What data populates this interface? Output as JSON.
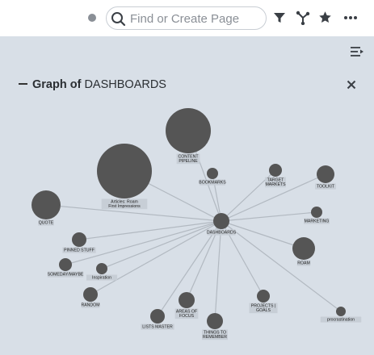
{
  "topbar": {
    "search_placeholder": "Find or Create Page",
    "icons": [
      "sync-status-dot",
      "search-icon",
      "filter-icon",
      "graph-icon",
      "star-icon",
      "more-icon"
    ]
  },
  "panel": {
    "title_prefix": "Graph of",
    "title_page": "DASHBOARDS"
  },
  "graph": {
    "center": "DASHBOARDS",
    "nodes": [
      {
        "id": "content-pipeline",
        "lines": [
          "CONTENT",
          "PIPELINE"
        ]
      },
      {
        "id": "articles-roam",
        "lines": [
          "Articles: Roam",
          "First Impressions"
        ]
      },
      {
        "id": "bookmarks",
        "lines": [
          "BOOKMARKS"
        ]
      },
      {
        "id": "target-markets",
        "lines": [
          "TARGET",
          "MARKETS"
        ]
      },
      {
        "id": "toolkit",
        "lines": [
          "TOOLKIT"
        ]
      },
      {
        "id": "quote",
        "lines": [
          "QUOTE"
        ]
      },
      {
        "id": "marketing",
        "lines": [
          "MARKETING"
        ]
      },
      {
        "id": "dashboards",
        "lines": [
          "DASHBOARDS"
        ]
      },
      {
        "id": "pinned-stuff",
        "lines": [
          "PINNED STUFF"
        ]
      },
      {
        "id": "roam",
        "lines": [
          "ROAM"
        ]
      },
      {
        "id": "someday-maybe",
        "lines": [
          "SOMEDAY/MAYBE"
        ]
      },
      {
        "id": "inspiration",
        "lines": [
          "Inspiration"
        ]
      },
      {
        "id": "random",
        "lines": [
          "RANDOM"
        ]
      },
      {
        "id": "areas-of-focus",
        "lines": [
          "AREAS OF",
          "FOCUS"
        ]
      },
      {
        "id": "projects-goals",
        "lines": [
          "PROJECTS |",
          "GOALS"
        ]
      },
      {
        "id": "lists-master",
        "lines": [
          "LISTS MASTER"
        ]
      },
      {
        "id": "things-to-remember",
        "lines": [
          "THINGS TO",
          "REMEMBER"
        ]
      },
      {
        "id": "procrastination",
        "lines": [
          "procrastination"
        ]
      }
    ],
    "colors": {
      "node": "#555555",
      "edge": "#b2b9c1",
      "label_bg": "#c7ced6"
    }
  }
}
